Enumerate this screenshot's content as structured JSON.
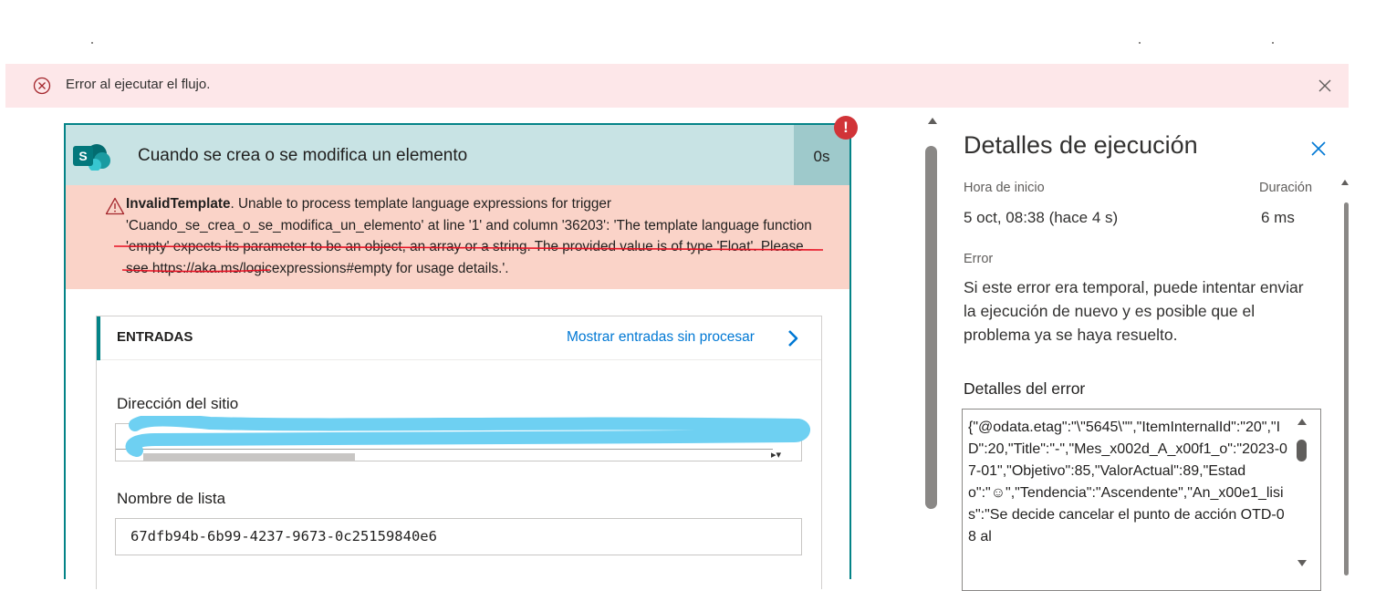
{
  "banner": {
    "message": "Error al ejecutar el flujo.",
    "icons": {
      "status": "error-circle-icon",
      "close": "close-icon"
    },
    "color": "#fde7e9"
  },
  "card": {
    "title": "Cuando se crea o se modifica un elemento",
    "duration": "0s",
    "error_badge": "!",
    "icons": {
      "connector": "sharepoint-icon",
      "warning": "warning-icon"
    },
    "accent": "#038387",
    "error": {
      "code": "InvalidTemplate",
      "message": ". Unable to process template language expressions for trigger 'Cuando_se_crea_o_se_modifica_un_elemento' at line '1' and column '36203': 'The template language function 'empty' expects its parameter to be an object, an array or a string. The provided value is of type 'Float'. Please see https://aka.ms/logicexpressions#empty for usage details.'."
    },
    "inputs": {
      "header": "ENTRADAS",
      "raw_link": "Mostrar entradas sin procesar",
      "site_label": "Dirección del sitio",
      "site_value": "",
      "list_label": "Nombre de lista",
      "list_value": "67dfb94b-6b99-4237-9673-0c25159840e6"
    }
  },
  "run_details": {
    "title": "Detalles de ejecución",
    "start_label": "Hora de inicio",
    "start_value": "5 oct, 08:38 (hace 4 s)",
    "duration_label": "Duración",
    "duration_value": "6 ms",
    "error_label": "Error",
    "error_message": "Si este error era temporal, puede intentar enviar la ejecución de nuevo y es posible que el problema ya se haya resuelto.",
    "details_heading": "Detalles del error",
    "details_text": "{\"@odata.etag\":\"\\\"5645\\\"\",\"ItemInternalId\":\"20\",\"ID\":20,\"Title\":\"-\",\"Mes_x002d_A_x00f1_o\":\"2023-07-01\",\"Objetivo\":85,\"ValorActual\":89,\"Estado\":\"☺\",\"Tendencia\":\"Ascendente\",\"An_x00e1_lisis\":\"Se decide cancelar el punto de acción OTD-08 al"
  }
}
